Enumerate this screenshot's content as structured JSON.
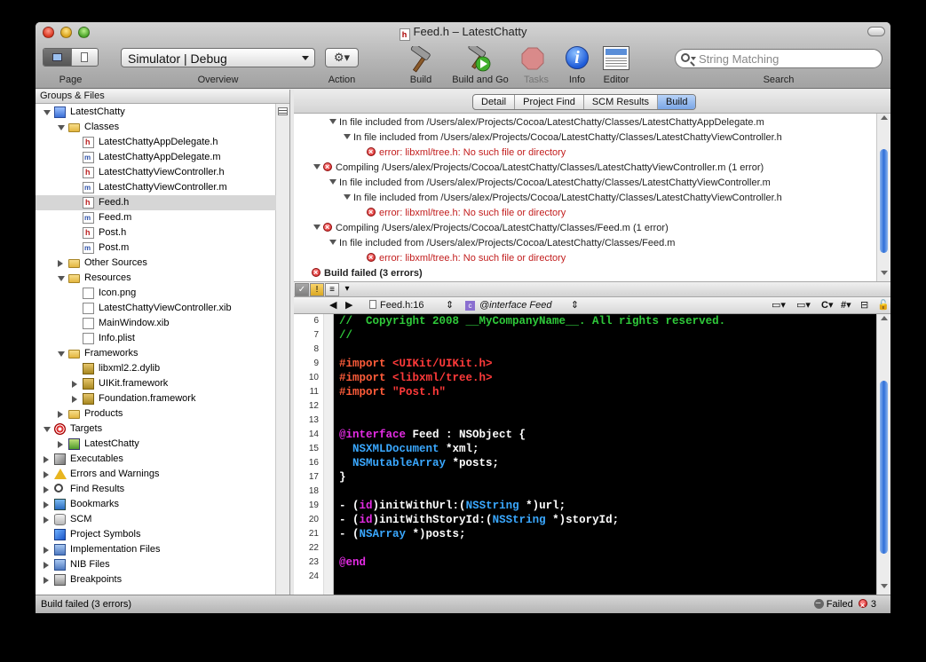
{
  "window": {
    "title": "Feed.h – LatestChatty",
    "title_icon": "h"
  },
  "toolbar": {
    "page_label": "Page",
    "overview_value": "Simulator | Debug",
    "overview_label": "Overview",
    "action_icon": "⚙▾",
    "action_label": "Action",
    "build_label": "Build",
    "build_and_go_label": "Build and Go",
    "tasks_label": "Tasks",
    "info_label": "Info",
    "info_glyph": "i",
    "editor_label": "Editor",
    "search_placeholder": "String Matching",
    "search_label": "Search"
  },
  "sidebar": {
    "header": "Groups & Files",
    "items": [
      {
        "label": "LatestChatty",
        "icon": "project-icon"
      },
      {
        "label": "Classes",
        "icon": "folder-icon"
      },
      {
        "label": "LatestChattyAppDelegate.h",
        "icon": "header-file-icon"
      },
      {
        "label": "LatestChattyAppDelegate.m",
        "icon": "source-file-icon"
      },
      {
        "label": "LatestChattyViewController.h",
        "icon": "header-file-icon"
      },
      {
        "label": "LatestChattyViewController.m",
        "icon": "source-file-icon"
      },
      {
        "label": "Feed.h",
        "icon": "header-file-icon"
      },
      {
        "label": "Feed.m",
        "icon": "source-file-icon"
      },
      {
        "label": "Post.h",
        "icon": "header-file-icon"
      },
      {
        "label": "Post.m",
        "icon": "source-file-icon"
      },
      {
        "label": "Other Sources",
        "icon": "folder-icon"
      },
      {
        "label": "Resources",
        "icon": "folder-icon"
      },
      {
        "label": "Icon.png",
        "icon": "image-file-icon"
      },
      {
        "label": "LatestChattyViewController.xib",
        "icon": "xib-file-icon"
      },
      {
        "label": "MainWindow.xib",
        "icon": "xib-file-icon"
      },
      {
        "label": "Info.plist",
        "icon": "plist-file-icon"
      },
      {
        "label": "Frameworks",
        "icon": "folder-icon"
      },
      {
        "label": "libxml2.2.dylib",
        "icon": "library-icon"
      },
      {
        "label": "UIKit.framework",
        "icon": "framework-icon"
      },
      {
        "label": "Foundation.framework",
        "icon": "framework-icon"
      },
      {
        "label": "Products",
        "icon": "folder-icon"
      },
      {
        "label": "Targets",
        "icon": "target-icon"
      },
      {
        "label": "LatestChatty",
        "icon": "app-target-icon"
      },
      {
        "label": "Executables",
        "icon": "executables-icon"
      },
      {
        "label": "Errors and Warnings",
        "icon": "warning-icon"
      },
      {
        "label": "Find Results",
        "icon": "magnifier-icon"
      },
      {
        "label": "Bookmarks",
        "icon": "bookmark-icon"
      },
      {
        "label": "SCM",
        "icon": "scm-icon"
      },
      {
        "label": "Project Symbols",
        "icon": "symbols-icon"
      },
      {
        "label": "Implementation Files",
        "icon": "implementation-icon"
      },
      {
        "label": "NIB Files",
        "icon": "nib-icon"
      },
      {
        "label": "Breakpoints",
        "icon": "breakpoints-icon"
      }
    ],
    "selected_index": 6
  },
  "tabs": [
    {
      "label": "Detail",
      "active": false
    },
    {
      "label": "Project Find",
      "active": false
    },
    {
      "label": "SCM Results",
      "active": false
    },
    {
      "label": "Build",
      "active": true
    }
  ],
  "build_results": [
    {
      "text": "In file included from /Users/alex/Projects/Cocoa/LatestChatty/Classes/LatestChattyAppDelegate.m",
      "kind": "include"
    },
    {
      "text": "In file included from /Users/alex/Projects/Cocoa/LatestChatty/Classes/LatestChattyViewController.h",
      "kind": "include"
    },
    {
      "text": "error: libxml/tree.h: No such file or directory",
      "kind": "error"
    },
    {
      "text": "Compiling /Users/alex/Projects/Cocoa/LatestChatty/Classes/LatestChattyViewController.m (1 error)",
      "kind": "compile"
    },
    {
      "text": "In file included from /Users/alex/Projects/Cocoa/LatestChatty/Classes/LatestChattyViewController.m",
      "kind": "include"
    },
    {
      "text": "In file included from /Users/alex/Projects/Cocoa/LatestChatty/Classes/LatestChattyViewController.h",
      "kind": "include"
    },
    {
      "text": "error: libxml/tree.h: No such file or directory",
      "kind": "error"
    },
    {
      "text": "Compiling /Users/alex/Projects/Cocoa/LatestChatty/Classes/Feed.m (1 error)",
      "kind": "compile"
    },
    {
      "text": "In file included from /Users/alex/Projects/Cocoa/LatestChatty/Classes/Feed.m",
      "kind": "include"
    },
    {
      "text": "error: libxml/tree.h: No such file or directory",
      "kind": "error"
    },
    {
      "text": "Build failed (3 errors)",
      "kind": "summary"
    }
  ],
  "editor": {
    "file_popup": "Feed.h:16",
    "symbol_popup": "@interface Feed",
    "symbol_badge": "c",
    "language_popup": "C",
    "hash_popup": "#",
    "line_numbers": [
      "6",
      "7",
      "8",
      "9",
      "10",
      "11",
      "12",
      "13",
      "14",
      "15",
      "16",
      "17",
      "18",
      "19",
      "20",
      "21",
      "22",
      "23",
      "24"
    ],
    "lines": [
      [
        {
          "t": "//  Copyright 2008 __MyCompanyName__. All rights reserved.",
          "c": "comment"
        }
      ],
      [
        {
          "t": "//",
          "c": "comment"
        }
      ],
      [],
      [
        {
          "t": "#import ",
          "c": "pre"
        },
        {
          "t": "<UIKit/UIKit.h>",
          "c": "str"
        }
      ],
      [
        {
          "t": "#import ",
          "c": "pre"
        },
        {
          "t": "<libxml/tree.h>",
          "c": "str"
        }
      ],
      [
        {
          "t": "#import ",
          "c": "pre"
        },
        {
          "t": "\"Post.h\"",
          "c": "str"
        }
      ],
      [],
      [],
      [
        {
          "t": "@interface",
          "c": "kw"
        },
        {
          "t": " Feed : NSObject {",
          "c": "plain"
        }
      ],
      [
        {
          "t": "  ",
          "c": "plain"
        },
        {
          "t": "NSXMLDocument",
          "c": "cls"
        },
        {
          "t": " *xml;",
          "c": "plain"
        }
      ],
      [
        {
          "t": "  ",
          "c": "plain"
        },
        {
          "t": "NSMutableArray",
          "c": "cls"
        },
        {
          "t": " *posts;",
          "c": "plain"
        }
      ],
      [
        {
          "t": "}",
          "c": "plain"
        }
      ],
      [],
      [
        {
          "t": "- (",
          "c": "plain"
        },
        {
          "t": "id",
          "c": "kw"
        },
        {
          "t": ")initWithUrl:(",
          "c": "plain"
        },
        {
          "t": "NSString",
          "c": "cls"
        },
        {
          "t": " *)url;",
          "c": "plain"
        }
      ],
      [
        {
          "t": "- (",
          "c": "plain"
        },
        {
          "t": "id",
          "c": "kw"
        },
        {
          "t": ")initWithStoryId:(",
          "c": "plain"
        },
        {
          "t": "NSString",
          "c": "cls"
        },
        {
          "t": " *)storyId;",
          "c": "plain"
        }
      ],
      [
        {
          "t": "- (",
          "c": "plain"
        },
        {
          "t": "NSArray",
          "c": "cls"
        },
        {
          "t": " *)posts;",
          "c": "plain"
        }
      ],
      [],
      [
        {
          "t": "@end",
          "c": "kw"
        }
      ],
      []
    ]
  },
  "statusbar": {
    "text": "Build failed (3 errors)",
    "result": "Failed",
    "error_count": "3"
  }
}
